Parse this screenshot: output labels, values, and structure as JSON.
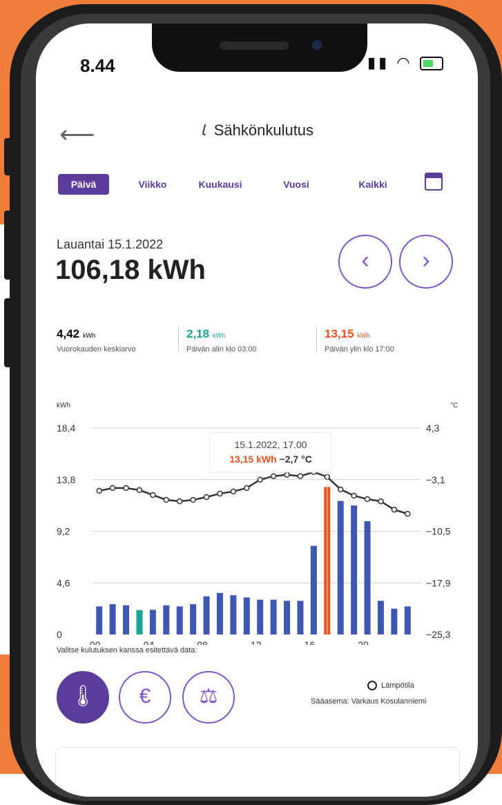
{
  "status_bar": {
    "time": "8.44",
    "signal_icon": "signal-bars-icon",
    "wifi_icon": "wifi-icon",
    "battery_icon": "battery-charging-icon"
  },
  "header": {
    "title": "Sähkönkulutus",
    "back_icon": "back-arrow-icon",
    "title_icon": "lightning-icon"
  },
  "tabs": [
    {
      "label": "Päivä",
      "active": true
    },
    {
      "label": "Viikko",
      "active": false
    },
    {
      "label": "Kuukausi",
      "active": false
    },
    {
      "label": "Vuosi",
      "active": false
    },
    {
      "label": "Kaikki",
      "active": false
    }
  ],
  "calendar_icon": "calendar-icon",
  "summary": {
    "date": "Lauantai 15.1.2022",
    "total": "106,18 kWh"
  },
  "stats": [
    {
      "value": "4,42",
      "unit": "kWh",
      "label": "Vuorokauden keskiarvo",
      "color": "#222222"
    },
    {
      "value": "2,18",
      "unit": "kWh",
      "label": "Päivän alin klo 03:00",
      "color": "#1aa397"
    },
    {
      "value": "13,15",
      "unit": "kWh",
      "label": "Päivän ylin klo 17:00",
      "color": "#f0501e"
    }
  ],
  "colors": {
    "accent": "#5b3c9b",
    "bar": "#3f57b0",
    "bar_min": "#1aa397",
    "bar_max": "#f0501e",
    "temp_line": "#333333",
    "orange_bg": "#ef7d3c"
  },
  "chart_data": {
    "type": "bar",
    "left_unit": "kWh",
    "right_unit": "°C",
    "y_left_ticks": [
      "18,4",
      "13,8",
      "9,2",
      "4,6",
      "0"
    ],
    "y_right_ticks": [
      "4,3",
      "−3,1",
      "−10,5",
      "−17,9",
      "−25,3"
    ],
    "ylim_left": [
      0,
      18.4
    ],
    "ylim_right": [
      -25.3,
      4.3
    ],
    "x_ticks": [
      "00",
      "04",
      "08",
      "12",
      "16",
      "20"
    ],
    "hours": [
      0,
      1,
      2,
      3,
      4,
      5,
      6,
      7,
      8,
      9,
      10,
      11,
      12,
      13,
      14,
      15,
      16,
      17,
      18,
      19,
      20,
      21,
      22,
      23
    ],
    "series": [
      {
        "name": "kWh",
        "values": [
          2.5,
          2.7,
          2.6,
          2.18,
          2.2,
          2.6,
          2.5,
          2.7,
          3.4,
          3.7,
          3.5,
          3.3,
          3.1,
          3.1,
          3.0,
          3.0,
          7.9,
          13.15,
          11.9,
          11.5,
          10.1,
          3.0,
          2.3,
          2.5
        ]
      },
      {
        "name": "Lämpötila",
        "values": [
          -4.7,
          -4.3,
          -4.3,
          -4.6,
          -5.3,
          -6.0,
          -6.2,
          -6.0,
          -5.6,
          -5.1,
          -4.8,
          -4.3,
          -3.1,
          -2.6,
          -2.4,
          -2.6,
          -2.0,
          -2.7,
          -4.5,
          -5.4,
          -5.9,
          -6.2,
          -7.4,
          -8.0
        ]
      }
    ],
    "tooltip": {
      "title": "15.1.2022, 17.00",
      "kwh": "13,15 kWh",
      "temp": "−2,7 °C"
    },
    "highlight_min_index": 3,
    "highlight_max_index": 17
  },
  "data_select": {
    "label": "Valitse kulutuksen kanssa esitettävä data:",
    "options": [
      {
        "icon": "thermometer-plus-icon",
        "active": true
      },
      {
        "icon": "euro-trend-icon",
        "active": false
      },
      {
        "icon": "scales-icon",
        "active": false
      }
    ],
    "legend_label": "Lämpötila",
    "station": "Sääasema: Varkaus Kosulanniemi"
  }
}
